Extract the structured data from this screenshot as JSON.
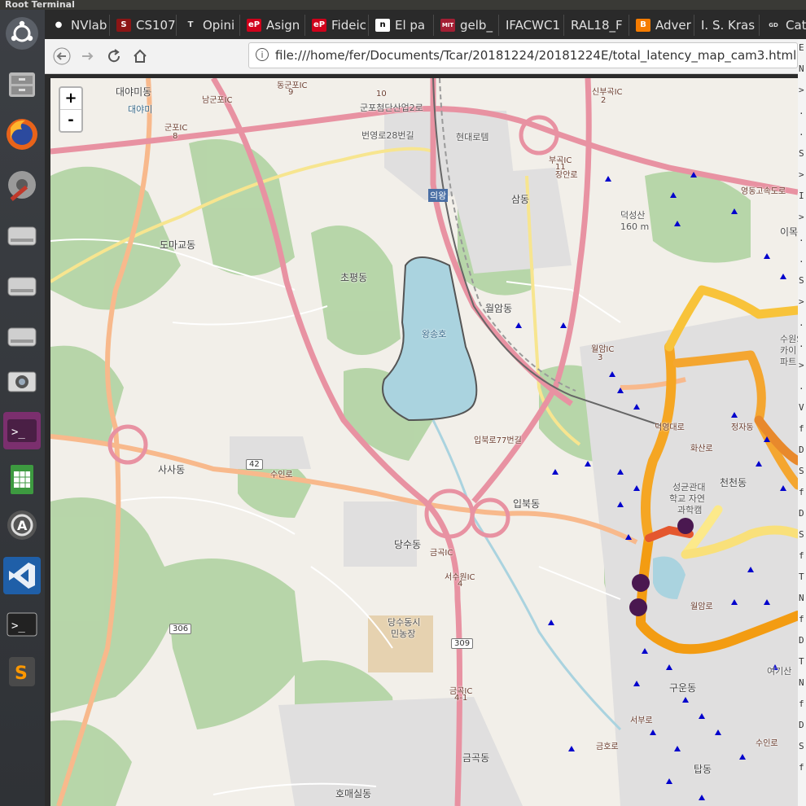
{
  "window": {
    "title": "Root Terminal"
  },
  "launcher": {
    "items": [
      {
        "name": "ubuntu-logo-icon"
      },
      {
        "name": "file-cabinet-icon"
      },
      {
        "name": "firefox-icon"
      },
      {
        "name": "system-settings-icon"
      },
      {
        "name": "drive-icon"
      },
      {
        "name": "drive-icon"
      },
      {
        "name": "drive-icon"
      },
      {
        "name": "camera-icon"
      },
      {
        "name": "terminal-icon"
      },
      {
        "name": "spreadsheet-icon"
      },
      {
        "name": "software-updater-icon"
      },
      {
        "name": "vscode-icon"
      },
      {
        "name": "terminal-icon"
      },
      {
        "name": "sublime-icon"
      }
    ]
  },
  "tabs": [
    {
      "label": "NVlab",
      "icon": "github-icon"
    },
    {
      "label": "CS107",
      "icon": "stanford-icon"
    },
    {
      "label": "Opini",
      "icon": "nytimes-icon"
    },
    {
      "label": "Asign",
      "icon": "ep-icon"
    },
    {
      "label": "Fideic",
      "icon": "ep-icon"
    },
    {
      "label": "El pa",
      "icon": "n-icon"
    },
    {
      "label": "gelb_",
      "icon": "mit-ocw-icon"
    },
    {
      "label": "IFACWC1",
      "icon": "page-icon"
    },
    {
      "label": "RAL18_F",
      "icon": "page-icon"
    },
    {
      "label": "Adver",
      "icon": "blogger-icon"
    },
    {
      "label": "I. S. Kras",
      "icon": "page-icon"
    },
    {
      "label": "Cat",
      "icon": "gdeq-icon"
    }
  ],
  "navbar": {
    "url": "file:///home/fer/Documents/Tcar/20181224/20181224E/total_latency_map_cam3.html"
  },
  "map": {
    "zoom_in": "+",
    "zoom_out": "-",
    "labels": [
      {
        "t": "대야미동"
      },
      {
        "t": "대야미"
      },
      {
        "t": "군포IC"
      },
      {
        "t": "8"
      },
      {
        "t": "남군포IC"
      },
      {
        "t": "동군포IC"
      },
      {
        "t": "9"
      },
      {
        "t": "10"
      },
      {
        "t": "군포첨단산업2로"
      },
      {
        "t": "번영로28번길"
      },
      {
        "t": "현대로템"
      },
      {
        "t": "신부곡IC"
      },
      {
        "t": "2"
      },
      {
        "t": "영동고속도로"
      },
      {
        "t": "부곡IC"
      },
      {
        "t": "11"
      },
      {
        "t": "의왕"
      },
      {
        "t": "삼동"
      },
      {
        "t": "장안로"
      },
      {
        "t": "덕성산"
      },
      {
        "t": "160 m"
      },
      {
        "t": "이목"
      },
      {
        "t": "도마교동"
      },
      {
        "t": "초평동"
      },
      {
        "t": "왕송호"
      },
      {
        "t": "월암동"
      },
      {
        "t": "월암IC"
      },
      {
        "t": "3"
      },
      {
        "t": "수원SK"
      },
      {
        "t": "카이"
      },
      {
        "t": "파트"
      },
      {
        "t": "사사동"
      },
      {
        "t": "42"
      },
      {
        "t": "수인로"
      },
      {
        "t": "입북로77번길"
      },
      {
        "t": "성균관대"
      },
      {
        "t": "학교 자연"
      },
      {
        "t": "과학캠"
      },
      {
        "t": "천천동"
      },
      {
        "t": "입북동"
      },
      {
        "t": "당수동"
      },
      {
        "t": "금곡IC"
      },
      {
        "t": "서수원IC"
      },
      {
        "t": "4"
      },
      {
        "t": "306"
      },
      {
        "t": "당수동시"
      },
      {
        "t": "민농장"
      },
      {
        "t": "309"
      },
      {
        "t": "금곡IC"
      },
      {
        "t": "4-1"
      },
      {
        "t": "금곡동"
      },
      {
        "t": "호매실동"
      },
      {
        "t": "구운동"
      },
      {
        "t": "여기산"
      },
      {
        "t": "탑동"
      },
      {
        "t": "서부로"
      },
      {
        "t": "금호로"
      },
      {
        "t": "수인로"
      },
      {
        "t": "정자동"
      },
      {
        "t": "화산로"
      },
      {
        "t": "덕영대로"
      },
      {
        "t": "월암로"
      }
    ]
  },
  "terminal_sliver": {
    "lines": [
      "E",
      "N",
      ">",
      ".",
      ".",
      "S",
      ">",
      "I",
      ">",
      ".",
      ".",
      "S",
      ">",
      ".",
      ".",
      ">",
      ".",
      "V",
      "f",
      "D",
      "S",
      "f",
      "D",
      "S",
      "f",
      "T",
      "N",
      "f",
      "D",
      "T",
      "N",
      "f",
      "D",
      "S",
      "f"
    ]
  }
}
